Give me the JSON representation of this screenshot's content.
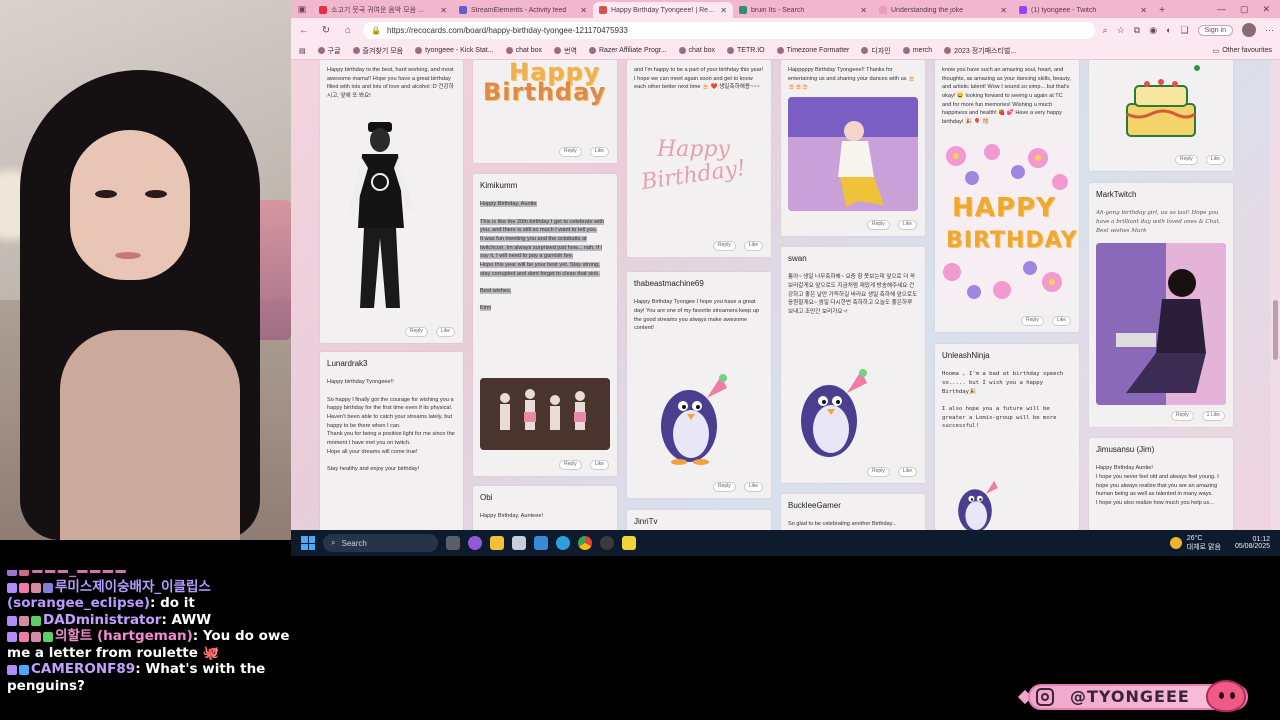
{
  "browser": {
    "tabs": [
      {
        "label": "소고기 뭇국 귀여운 음악 모음 ...",
        "color": "#e2323f",
        "active": false
      },
      {
        "label": "StreamElements - Activity feed",
        "color": "#6a5acd",
        "active": false
      },
      {
        "label": "Happy Birthday Tyongeee! | Reco...",
        "color": "#d9534f",
        "active": true
      },
      {
        "label": "bruin Its - Search",
        "color": "#2f8f6f",
        "active": false
      },
      {
        "label": "Understanding the joke",
        "color": "#e8a0b4",
        "active": false
      },
      {
        "label": "(1) tyongeee - Twitch",
        "color": "#9146ff",
        "active": false
      }
    ],
    "new_tab": "+",
    "url": "https://recocards.com/board/happy-birthday-tyongee-121170475933",
    "sign_in": "Sign in",
    "bookmarks": [
      "구글",
      "즐겨찾기 모음",
      "tyongeee - Kick Stat...",
      "chat box",
      "번역",
      "Razer Affiliate Progr...",
      "chat box",
      "TETR.IO",
      "Timezone Formatter",
      "디자인",
      "merch",
      "2023 정기패스티벌..."
    ],
    "other_bookmarks": "Other favourites"
  },
  "cards": {
    "c1_text": "Happy birthday to the best, hard working, and most awesome mama!! Hope you have a great birthday filled with lots and lots of love and alcohol :D 건강하시고, 앞에 또 봐요!",
    "lunardrak_name": "Lunardrak3",
    "lunardrak_text1": "Happy birthday Tyongeee!!",
    "lunardrak_text2": "So happy I finally got the courage for wishing you a happy birthday for the first time even if its physical.",
    "lunardrak_text3": "Haven't been able to catch your streams lately, but happy to be there when I can.",
    "lunardrak_text4": "Thank you for being a positive light for me since the moment I have met you on twitch.",
    "lunardrak_text5": "Hope all your dreams will come true!",
    "lunardrak_text6": "Stay healthy and enjoy your birthday!",
    "happy": "Happy",
    "birthday": "Birthday",
    "kimikumm_name": "Kimikumm",
    "kimikumm_text1": "Happy Birthday, Auntie",
    "kimikumm_text2": "This is like the 20th birthday I get to celebrate with you, and there is still so much I want to tell you.",
    "kimikumm_text3": "It was fun meeting you and the octobutts at twitchcon. Im always surprised just how... nah, if I say it, I will need to pay a garnish fee.",
    "kimikumm_text4": "Hope this year will be your best yet. Stay strong, stay corrupted and dont forget to clean that sink.",
    "kimikumm_text5": "Best wishes,",
    "kimikumm_text6": "Kimi",
    "obi_name": "Obi",
    "obi_text": "Happy Birthday, Aunteee!",
    "c3_text": "and I'm happy to be a part of your birthday this year! I hope we can meet again soon and get to know each other better next time 🎂 ❤️ 생일축하해용~~~",
    "script_happy": "Happy",
    "script_birthday": "Birthday!",
    "thabeast_name": "thabeastmachine69",
    "thabeast_text": "Happy Birthday Tyongee I hope you have a great day! You are one of my favorite streamers keep up the good streams you always make awesome content!",
    "jinri_name": "JinriTv",
    "c4_text": "Happpppy Birthday Tyongeee!! Thanks for entertaining us and sharing your dances with us 🎂🎂🎂🎂",
    "swan_name": "swan",
    "swan_text": "통아~ 생일 너무축하해~ 요즘 항 못보는데 앞으로 더 꼭 보러갈게요 앞으로도 지금처럼 재밌게 방송해주세요 건강하고 좋은 날만 가득하길 바라요 생일 축하해 앞으로도 응원할게요~ 생일 다시한번 축하하고 오늘도 좋은하루 보내고 조만간 보러가요~!",
    "bucklee_name": "BuckleeGamer",
    "bucklee_text": "So glad to be celebrating another Birthday...",
    "c5_text": "know you have such an amazing soul, heart, and thoughts, as amazing as your dancing skills, beauty, and artistic talent! Wow I sound so simp... but that's okay! 😄 looking forward to seeing u again at TC and for more fun memories! Wishing u much happiness and health! 🍓 💕 Have a very happy birthday! 🎉 🎈 🎊",
    "big_happy": "HAPPY",
    "big_birthday": "BIRTHDAY",
    "unleash_name": "UnleashNinja",
    "unleash_text1": "Hooma , I'm a bad at birthday speech so..... but I wish you a happy Birthday🎉",
    "unleash_text2": "I also hope you a future will be greater a Lomix-group will be more successful!",
    "marktwitch_name": "MarkTwitch",
    "marktwitch_text": "Ah-gong birthday girl, uu so lasl! Hope you have a brilliant day with loved ones & Chat. Best wishes Mark",
    "jimusansu_name": "Jimusansu (Jim)",
    "jimusansu_text1": "Happy Birthday Auntie!",
    "jimusansu_text2": "I hope you never feel old and always feel young. I hope you always realize that you are an amazing human being as well as talented in many ways.",
    "jimusansu_text3": "I hope you also realize how much you help us...",
    "reply": "Reply",
    "like": "Like",
    "like1": "1 Like"
  },
  "taskbar": {
    "search": "Search",
    "temp": "26°C",
    "weather": "대체로 맑음",
    "time": "01:12",
    "date": "05/08/2025"
  },
  "chat": {
    "line0_user": "▬▬▬_▬▬▬▬",
    "line1_user": "루미스제이숭배자_이클립스 (sorangee_eclipse)",
    "line1_msg": "do it",
    "line2_user": "DADministrator",
    "line2_msg": "AWW",
    "line3_user": "의할트 (hartgeman)",
    "line3_msg": "You do owe me a letter from roulette 🐙",
    "line4_user": "CAMERONF89",
    "line4_msg": "What's with the penguins?"
  },
  "social": {
    "handle": "@TYONGEEE"
  }
}
